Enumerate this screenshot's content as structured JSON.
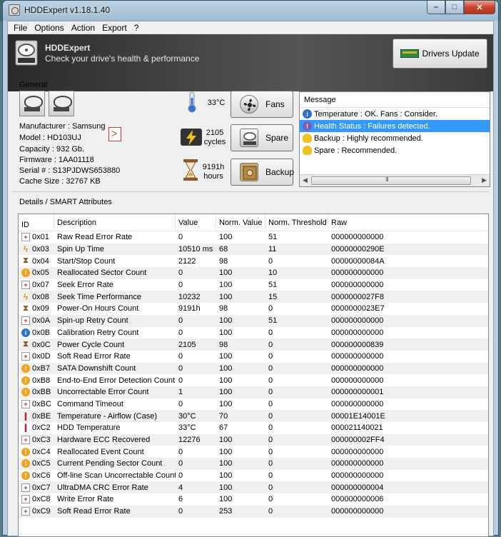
{
  "window": {
    "title": "HDDExpert v1.18.1.40",
    "min_glyph": "–",
    "max_glyph": "□",
    "close_glyph": "✕"
  },
  "menu": [
    "File",
    "Options",
    "Action",
    "Export",
    "?"
  ],
  "banner": {
    "title": "HDDExpert",
    "subtitle": "Check your drive's health & performance",
    "drivers_button": "Drivers Update"
  },
  "general": {
    "label": "General",
    "manufacturer": "Manufacturer : Samsung",
    "model": "Model : HD103UJ",
    "capacity": "Capacity : 932 Gb.",
    "firmware": "Firmware : 1AA01118",
    "serial": "Serial # : S13PJDWS653880",
    "cache": "Cache Size : 32767 KB"
  },
  "stats": {
    "temperature": "33°C",
    "cycles_value": "2105",
    "cycles_unit": "cycles",
    "hours_value": "9191h",
    "hours_unit": "hours"
  },
  "buttons": {
    "fans": "Fans",
    "spare": "Spare",
    "backup": "Backup"
  },
  "messages": {
    "header": "Message",
    "items": [
      {
        "text": "Temperature : OK. Fans : Consider.",
        "icon": "info-icon"
      },
      {
        "text": "Health Status : Failures detected.",
        "icon": "health-icon",
        "selected": true
      },
      {
        "text": "Backup : Highly recommended.",
        "icon": "bulb-icon"
      },
      {
        "text": "Spare : Recommended.",
        "icon": "bulb-icon"
      }
    ],
    "scroll_grip": "III"
  },
  "details": {
    "label": "Details / SMART Attributes",
    "columns": [
      "ID",
      "Description",
      "Value",
      "Norm. Value",
      "Norm. Threshold",
      "Raw"
    ],
    "rows": [
      {
        "icon": "plus",
        "id": "0x01",
        "desc": "Raw Read Error Rate",
        "value": "0",
        "norm": "100",
        "thr": "51",
        "raw": "000000000000"
      },
      {
        "icon": "flash",
        "id": "0x03",
        "desc": "Spin Up Time",
        "value": "10510 ms",
        "norm": "68",
        "thr": "11",
        "raw": "00000000290E"
      },
      {
        "icon": "hour",
        "id": "0x04",
        "desc": "Start/Stop Count",
        "value": "2122",
        "norm": "98",
        "thr": "0",
        "raw": "00000000084A"
      },
      {
        "icon": "warn",
        "id": "0x05",
        "desc": "Reallocated Sector Count",
        "value": "0",
        "norm": "100",
        "thr": "10",
        "raw": "000000000000"
      },
      {
        "icon": "plus",
        "id": "0x07",
        "desc": "Seek Error Rate",
        "value": "0",
        "norm": "100",
        "thr": "51",
        "raw": "000000000000"
      },
      {
        "icon": "flash",
        "id": "0x08",
        "desc": "Seek Time Performance",
        "value": "10232",
        "norm": "100",
        "thr": "15",
        "raw": "0000000027F8"
      },
      {
        "icon": "hour",
        "id": "0x09",
        "desc": "Power-On Hours Count",
        "value": "9191h",
        "norm": "98",
        "thr": "0",
        "raw": "0000000023E7"
      },
      {
        "icon": "plus",
        "id": "0x0A",
        "desc": "Spin-up Retry Count",
        "value": "0",
        "norm": "100",
        "thr": "51",
        "raw": "000000000000"
      },
      {
        "icon": "info",
        "id": "0x0B",
        "desc": "Calibration Retry Count",
        "value": "0",
        "norm": "100",
        "thr": "0",
        "raw": "000000000000"
      },
      {
        "icon": "hour",
        "id": "0x0C",
        "desc": "Power Cycle Count",
        "value": "2105",
        "norm": "98",
        "thr": "0",
        "raw": "000000000839"
      },
      {
        "icon": "plus",
        "id": "0x0D",
        "desc": "Soft Read Error Rate",
        "value": "0",
        "norm": "100",
        "thr": "0",
        "raw": "000000000000"
      },
      {
        "icon": "warn",
        "id": "0xB7",
        "desc": "SATA Downshift Count",
        "value": "0",
        "norm": "100",
        "thr": "0",
        "raw": "000000000000"
      },
      {
        "icon": "warn",
        "id": "0xB8",
        "desc": "End-to-End Error Detection Count",
        "value": "0",
        "norm": "100",
        "thr": "0",
        "raw": "000000000000"
      },
      {
        "icon": "warn",
        "id": "0xBB",
        "desc": "Uncorrectable Error Count",
        "value": "1",
        "norm": "100",
        "thr": "0",
        "raw": "000000000001"
      },
      {
        "icon": "plus",
        "id": "0xBC",
        "desc": "Command Timeout",
        "value": "0",
        "norm": "100",
        "thr": "0",
        "raw": "000000000000"
      },
      {
        "icon": "temp",
        "id": "0xBE",
        "desc": "Temperature - Airflow (Case)",
        "value": "30°C",
        "norm": "70",
        "thr": "0",
        "raw": "00001E14001E"
      },
      {
        "icon": "temp",
        "id": "0xC2",
        "desc": "HDD Temperature",
        "value": "33°C",
        "norm": "67",
        "thr": "0",
        "raw": "000021140021"
      },
      {
        "icon": "plus",
        "id": "0xC3",
        "desc": "Hardware ECC Recovered",
        "value": "12276",
        "norm": "100",
        "thr": "0",
        "raw": "000000002FF4"
      },
      {
        "icon": "warn",
        "id": "0xC4",
        "desc": "Reallocated Event Count",
        "value": "0",
        "norm": "100",
        "thr": "0",
        "raw": "000000000000"
      },
      {
        "icon": "warn",
        "id": "0xC5",
        "desc": "Current Pending Sector Count",
        "value": "0",
        "norm": "100",
        "thr": "0",
        "raw": "000000000000"
      },
      {
        "icon": "warn",
        "id": "0xC6",
        "desc": "Off-line Scan Uncorrectable Count",
        "value": "0",
        "norm": "100",
        "thr": "0",
        "raw": "000000000000"
      },
      {
        "icon": "plus",
        "id": "0xC7",
        "desc": "UltraDMA CRC Error Rate",
        "value": "4",
        "norm": "100",
        "thr": "0",
        "raw": "000000000004"
      },
      {
        "icon": "plus",
        "id": "0xC8",
        "desc": "Write Error Rate",
        "value": "6",
        "norm": "100",
        "thr": "0",
        "raw": "000000000006"
      },
      {
        "icon": "plus",
        "id": "0xC9",
        "desc": "Soft Read Error Rate",
        "value": "0",
        "norm": "253",
        "thr": "0",
        "raw": "000000000000"
      }
    ]
  },
  "colors": {
    "selection": "#3399ff",
    "warn": "#f2a21e",
    "info": "#2f6fcf",
    "banner": "#3a3a3a"
  }
}
